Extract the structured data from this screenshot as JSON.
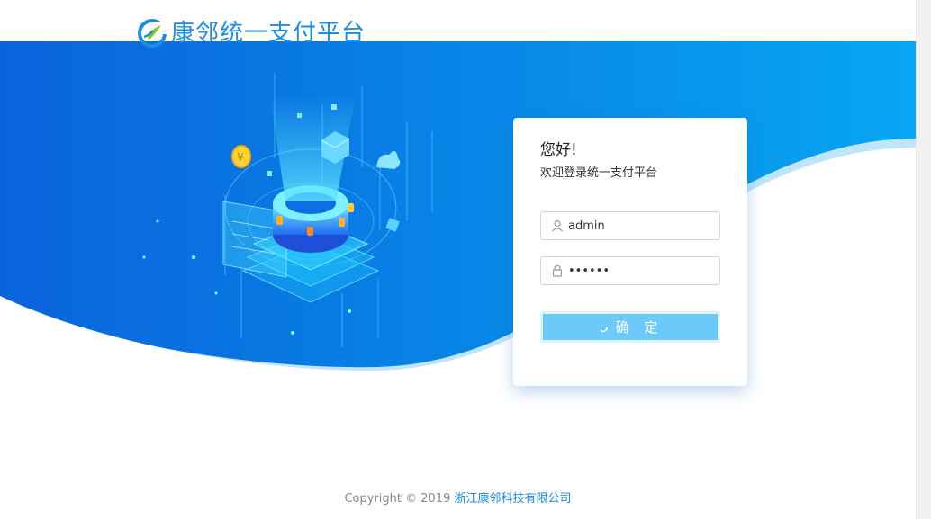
{
  "header": {
    "brand_name": "康邻统一支付平台",
    "brand_color": "#1c8de0"
  },
  "login": {
    "greeting": "您好!",
    "welcome": "欢迎登录统一支付平台",
    "username": {
      "value": "admin",
      "icon": "user-icon"
    },
    "password": {
      "value": "••••••",
      "icon": "lock-icon"
    },
    "submit_label": "确 定",
    "submit_state": "loading"
  },
  "footer": {
    "copyright": "Copyright © 2019 ",
    "company": "浙江康邻科技有限公司"
  },
  "colors": {
    "banner_start": "#0a63db",
    "banner_end": "#07a6f2",
    "button": "#6ccaf8",
    "link": "#1787d8"
  }
}
